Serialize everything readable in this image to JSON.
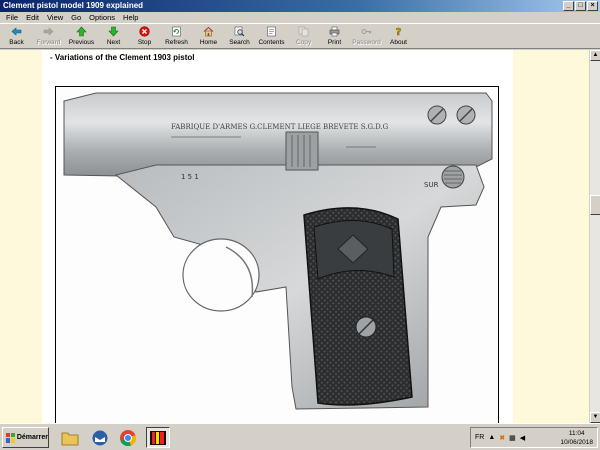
{
  "window": {
    "title": "Clement pistol model 1909 explained"
  },
  "menu": [
    "File",
    "Edit",
    "View",
    "Go",
    "Options",
    "Help"
  ],
  "toolbar": {
    "back": "Back",
    "forward": "Forward",
    "previous": "Previous",
    "next": "Next",
    "stop": "Stop",
    "refresh": "Refresh",
    "home": "Home",
    "search": "Search",
    "contents": "Contents",
    "copy": "Copy",
    "print": "Print",
    "password": "Password",
    "about": "About"
  },
  "page": {
    "heading": "- Variations of the Clement 1903 pistol",
    "engraving": "FABRIQUE D'ARMES G.CLEMENT LIEGE BREVETE S.G.D.G",
    "serial": "1 5 1",
    "marking": "SUR"
  },
  "taskbar": {
    "start": "Démarrer",
    "lang": "FR",
    "time": "11:04",
    "date": "10/06/2018"
  },
  "colors": {
    "titlebar_start": "#0a246a",
    "content_bg": "#fff9dc",
    "chrome": "#d4d0c8"
  }
}
